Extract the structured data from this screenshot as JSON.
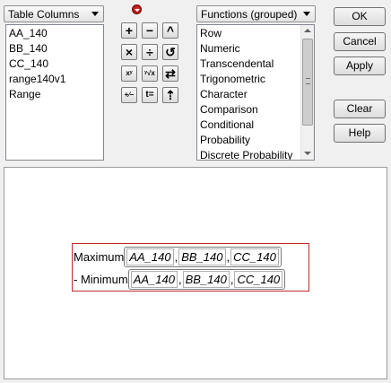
{
  "columns_dropdown": {
    "label": "Table Columns"
  },
  "columns_list": [
    "AA_140",
    "BB_140",
    "CC_140",
    "range140v1",
    "Range"
  ],
  "functions_dropdown": {
    "label": "Functions (grouped)"
  },
  "functions_list": [
    "Row",
    "Numeric",
    "Transcendental",
    "Trigonometric",
    "Character",
    "Comparison",
    "Conditional",
    "Probability",
    "Discrete Probability"
  ],
  "operators": {
    "add": "+",
    "subtract": "−",
    "raise": "^",
    "multiply": "×",
    "divide": "÷",
    "rotate": "↺",
    "power": "xʸ",
    "root": "ʸ√x",
    "swap": "⇄",
    "negate": "+∕−",
    "assign": "t=",
    "peel": "⇡"
  },
  "buttons": {
    "ok": "OK",
    "cancel": "Cancel",
    "apply": "Apply",
    "clear": "Clear",
    "help": "Help"
  },
  "formula": {
    "row1_func": "Maximum",
    "row2_prefix": "- ",
    "row2_func": "Minimum",
    "args": [
      "AA_140",
      "BB_140",
      "CC_140"
    ],
    "comma": ","
  }
}
